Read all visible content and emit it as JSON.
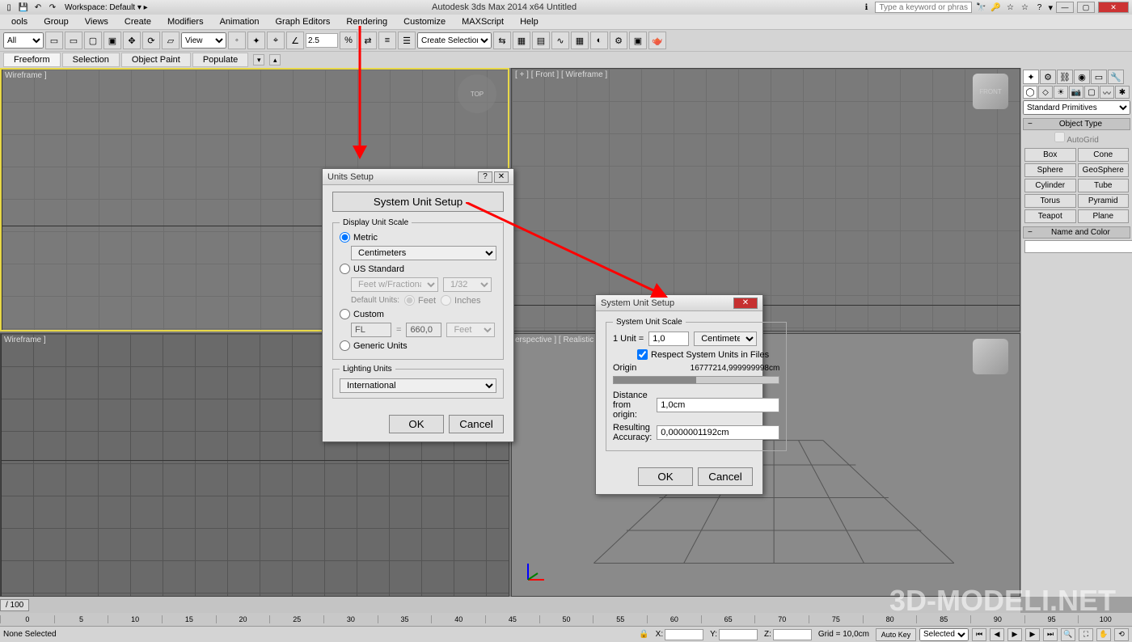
{
  "app": {
    "title": "Autodesk 3ds Max 2014 x64   Untitled",
    "search_placeholder": "Type a keyword or phrase",
    "workspace_label": "Workspace: Default"
  },
  "menu": {
    "items": [
      "ools",
      "Group",
      "Views",
      "Create",
      "Modifiers",
      "Animation",
      "Graph Editors",
      "Rendering",
      "Customize",
      "MAXScript",
      "Help"
    ],
    "highlighted": "Customize"
  },
  "toolbar": {
    "all_dropdown": "All",
    "view_dropdown": "View",
    "spin_value": "2.5",
    "create_selection": "Create Selection Se"
  },
  "ribbon": {
    "tabs": [
      "Freeform",
      "Selection",
      "Object Paint",
      "Populate"
    ]
  },
  "viewports": {
    "top": "Wireframe ]",
    "front": "[ + ] [ Front ] [ Wireframe ]",
    "left": "Wireframe ]",
    "persp": "erspective ] [ Realistic ]"
  },
  "cmdpanel": {
    "category": "Standard Primitives",
    "rollout_objtype": "Object Type",
    "autogrid": "AutoGrid",
    "primitives": [
      "Box",
      "Cone",
      "Sphere",
      "GeoSphere",
      "Cylinder",
      "Tube",
      "Torus",
      "Pyramid",
      "Teapot",
      "Plane"
    ],
    "rollout_namecolor": "Name and Color"
  },
  "timeslider": {
    "label": "/ 100",
    "zero": "0"
  },
  "timeline_ticks": [
    "0",
    "5",
    "10",
    "15",
    "20",
    "25",
    "30",
    "35",
    "40",
    "45",
    "50",
    "55",
    "60",
    "65",
    "70",
    "75",
    "80",
    "85",
    "90",
    "95",
    "100"
  ],
  "status": {
    "sel": "None Selected",
    "x": "X:",
    "y": "Y:",
    "z": "Z:",
    "grid": "Grid = 10,0cm",
    "autokey": "Auto Key",
    "selected": "Selected"
  },
  "dialog1": {
    "title": "Units Setup",
    "sysbtn": "System Unit Setup",
    "fieldset": "Display Unit Scale",
    "metric": "Metric",
    "metric_val": "Centimeters",
    "us": "US Standard",
    "us_val": "Feet w/Fractional Inches",
    "us_frac": "1/32",
    "default_units": "Default Units:",
    "feet": "Feet",
    "inches": "Inches",
    "custom": "Custom",
    "custom_fl": "FL",
    "custom_eq": "=",
    "custom_val": "660,0",
    "custom_unit": "Feet",
    "generic": "Generic Units",
    "lighting_fs": "Lighting Units",
    "lighting_val": "International",
    "ok": "OK",
    "cancel": "Cancel"
  },
  "dialog2": {
    "title": "System Unit Setup",
    "fs": "System Unit Scale",
    "unit_label": "1 Unit =",
    "unit_val": "1,0",
    "unit_dd": "Centimeters",
    "respect": "Respect System Units in Files",
    "origin": "Origin",
    "origin_val": "16777214,999999998cm",
    "dist": "Distance from origin:",
    "dist_val": "1,0cm",
    "accuracy": "Resulting Accuracy:",
    "accuracy_val": "0,0000001192cm",
    "ok": "OK",
    "cancel": "Cancel"
  },
  "watermark": "3D-MODELI.NET"
}
